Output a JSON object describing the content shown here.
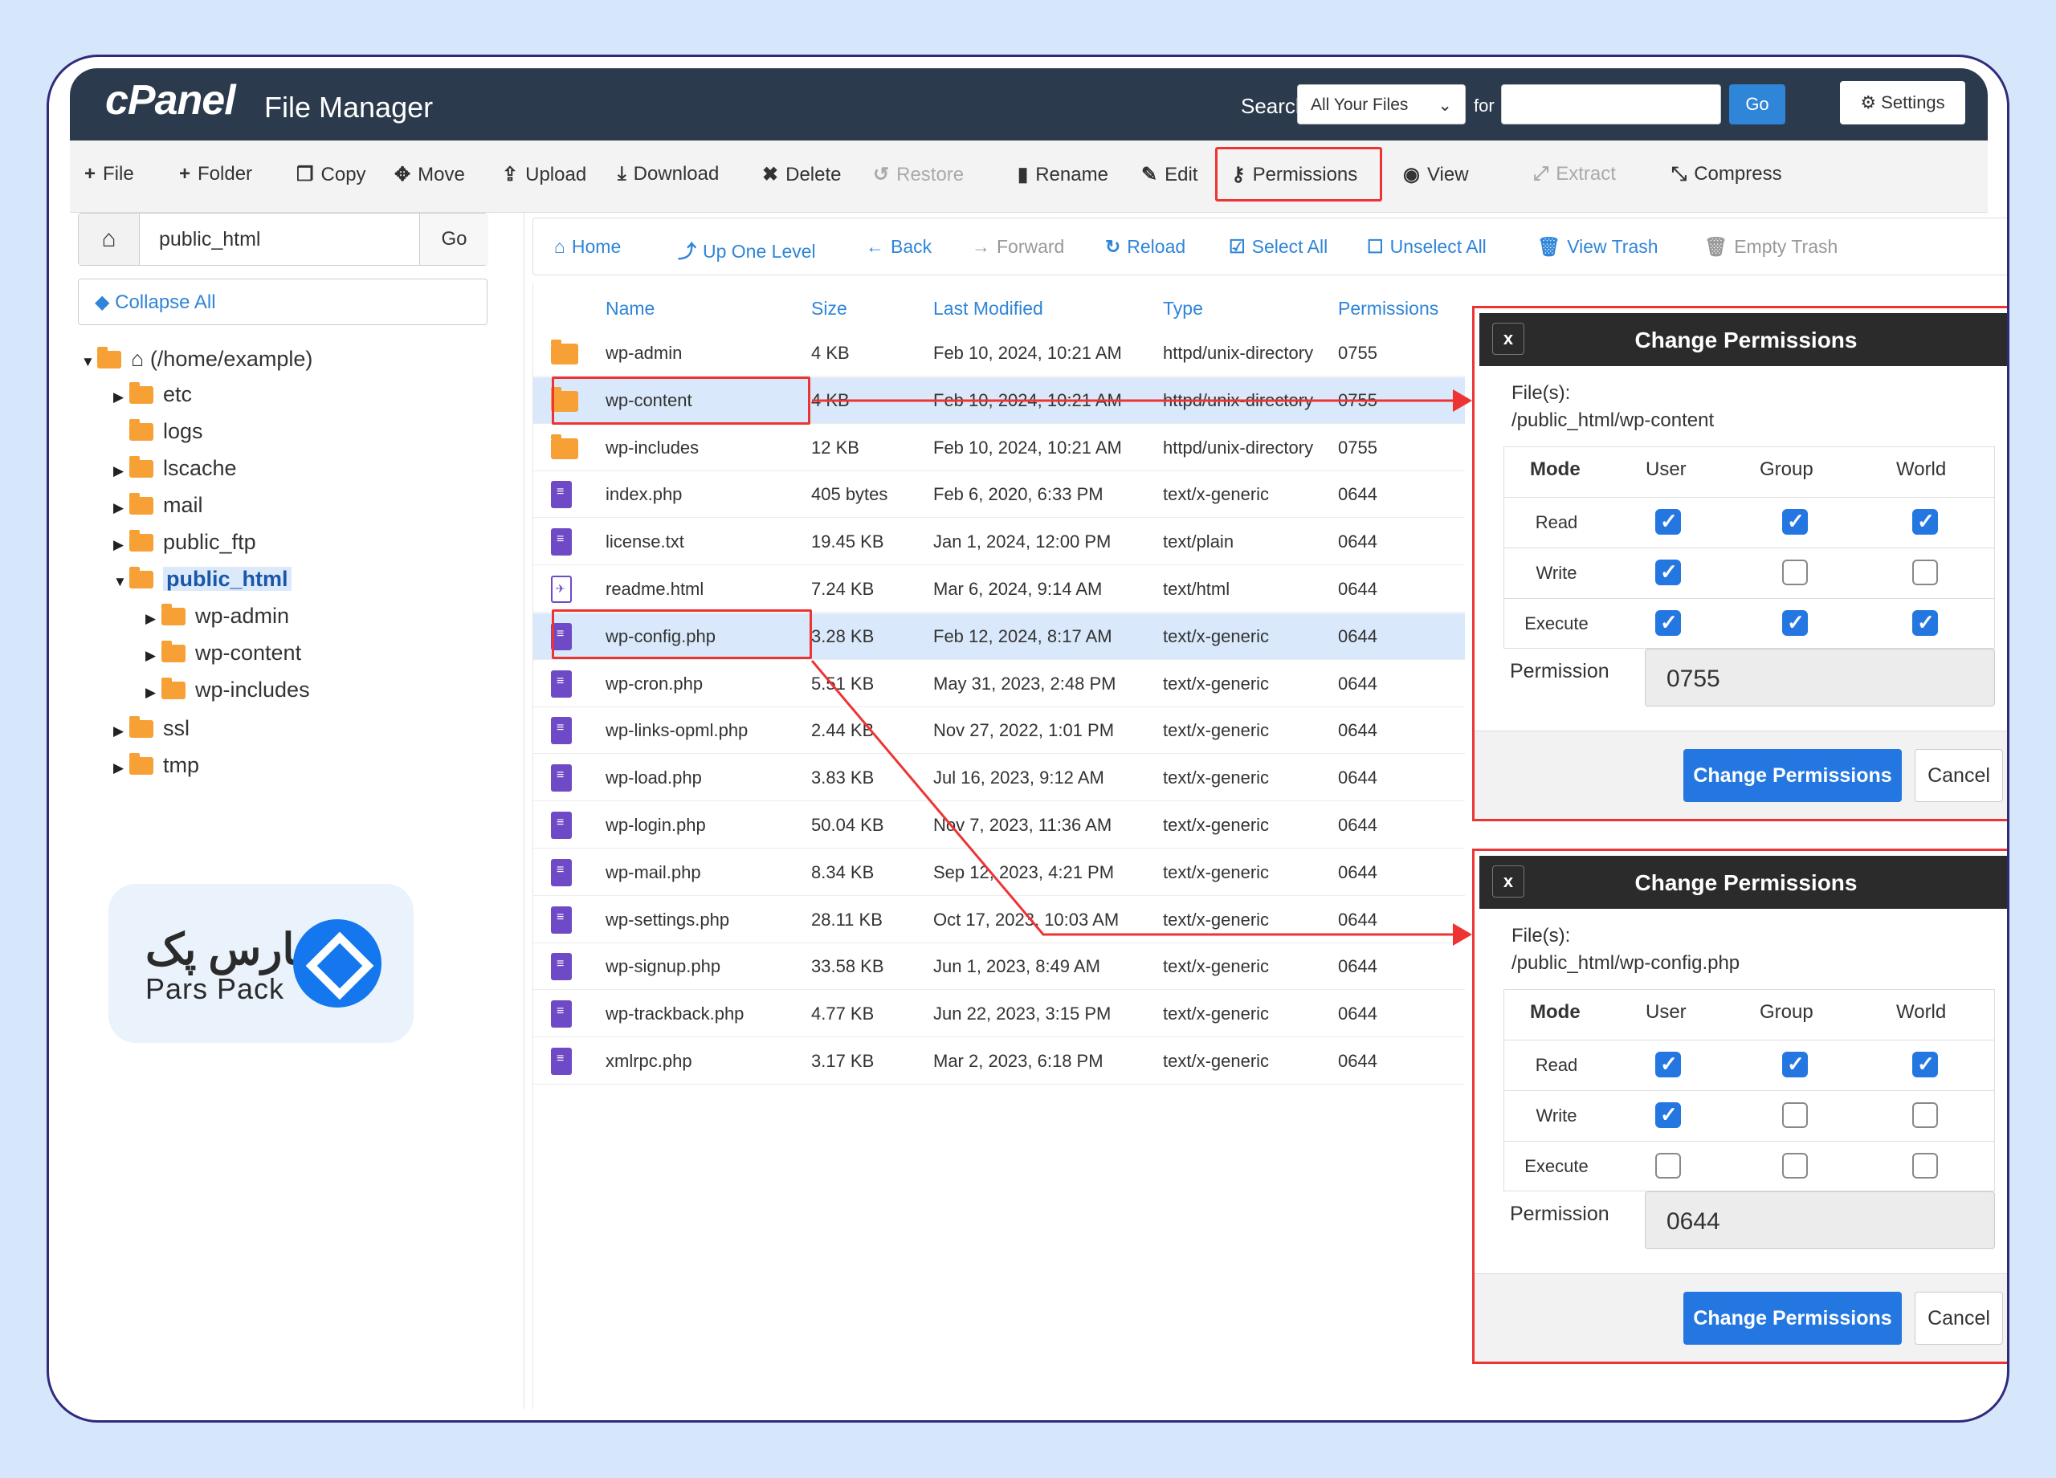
{
  "header": {
    "logo": "cPanel",
    "app_title": "File Manager",
    "search_label": "Search",
    "search_scope": "All Your Files",
    "for_label": "for",
    "search_value": "",
    "go_label": "Go",
    "settings_label": "Settings"
  },
  "toolbar": {
    "file": "File",
    "folder": "Folder",
    "copy": "Copy",
    "move": "Move",
    "upload": "Upload",
    "download": "Download",
    "delete": "Delete",
    "restore": "Restore",
    "rename": "Rename",
    "edit": "Edit",
    "permissions": "Permissions",
    "view": "View",
    "extract": "Extract",
    "compress": "Compress"
  },
  "sidebar": {
    "path": "public_html",
    "go": "Go",
    "collapse_all": "Collapse All",
    "tree": {
      "root": "(/home/example)",
      "etc": "etc",
      "logs": "logs",
      "lscache": "lscache",
      "mail": "mail",
      "public_ftp": "public_ftp",
      "public_html": "public_html",
      "wp_admin": "wp-admin",
      "wp_content": "wp-content",
      "wp_includes": "wp-includes",
      "ssl": "ssl",
      "tmp": "tmp"
    }
  },
  "brand": {
    "fa": "پارس پک",
    "en": "Pars Pack"
  },
  "nav": {
    "home": "Home",
    "up": "Up One Level",
    "back": "Back",
    "forward": "Forward",
    "reload": "Reload",
    "select_all": "Select All",
    "unselect_all": "Unselect All",
    "view_trash": "View Trash",
    "empty_trash": "Empty Trash"
  },
  "table": {
    "headers": {
      "name": "Name",
      "size": "Size",
      "modified": "Last Modified",
      "type": "Type",
      "permissions": "Permissions"
    },
    "rows": [
      {
        "name": "wp-admin",
        "size": "4 KB",
        "modified": "Feb 10, 2024, 10:21 AM",
        "type": "httpd/unix-directory",
        "perm": "0755"
      },
      {
        "name": "wp-content",
        "size": "4 KB",
        "modified": "Feb 10, 2024, 10:21 AM",
        "type": "httpd/unix-directory",
        "perm": "0755"
      },
      {
        "name": "wp-includes",
        "size": "12 KB",
        "modified": "Feb 10, 2024, 10:21 AM",
        "type": "httpd/unix-directory",
        "perm": "0755"
      },
      {
        "name": "index.php",
        "size": "405 bytes",
        "modified": "Feb 6, 2020, 6:33 PM",
        "type": "text/x-generic",
        "perm": "0644"
      },
      {
        "name": "license.txt",
        "size": "19.45 KB",
        "modified": "Jan 1, 2024, 12:00 PM",
        "type": "text/plain",
        "perm": "0644"
      },
      {
        "name": "readme.html",
        "size": "7.24 KB",
        "modified": "Mar 6, 2024, 9:14 AM",
        "type": "text/html",
        "perm": "0644"
      },
      {
        "name": "wp-config.php",
        "size": "3.28 KB",
        "modified": "Feb 12, 2024, 8:17 AM",
        "type": "text/x-generic",
        "perm": "0644"
      },
      {
        "name": "wp-cron.php",
        "size": "5.51 KB",
        "modified": "May 31, 2023, 2:48 PM",
        "type": "text/x-generic",
        "perm": "0644"
      },
      {
        "name": "wp-links-opml.php",
        "size": "2.44 KB",
        "modified": "Nov 27, 2022, 1:01 PM",
        "type": "text/x-generic",
        "perm": "0644"
      },
      {
        "name": "wp-load.php",
        "size": "3.83 KB",
        "modified": "Jul 16, 2023, 9:12 AM",
        "type": "text/x-generic",
        "perm": "0644"
      },
      {
        "name": "wp-login.php",
        "size": "50.04 KB",
        "modified": "Nov 7, 2023, 11:36 AM",
        "type": "text/x-generic",
        "perm": "0644"
      },
      {
        "name": "wp-mail.php",
        "size": "8.34 KB",
        "modified": "Sep 12, 2023, 4:21 PM",
        "type": "text/x-generic",
        "perm": "0644"
      },
      {
        "name": "wp-settings.php",
        "size": "28.11 KB",
        "modified": "Oct 17, 2023, 10:03 AM",
        "type": "text/x-generic",
        "perm": "0644"
      },
      {
        "name": "wp-signup.php",
        "size": "33.58 KB",
        "modified": "Jun 1, 2023, 8:49 AM",
        "type": "text/x-generic",
        "perm": "0644"
      },
      {
        "name": "wp-trackback.php",
        "size": "4.77 KB",
        "modified": "Jun 22, 2023, 3:15 PM",
        "type": "text/x-generic",
        "perm": "0644"
      },
      {
        "name": "xmlrpc.php",
        "size": "3.17 KB",
        "modified": "Mar 2, 2023, 6:18 PM",
        "type": "text/x-generic",
        "perm": "0644"
      }
    ]
  },
  "dialog_labels": {
    "close": "x",
    "title": "Change Permissions",
    "files_label": "File(s):",
    "mode": "Mode",
    "user": "User",
    "group": "Group",
    "world": "World",
    "read": "Read",
    "write": "Write",
    "execute": "Execute",
    "permission_label": "Permission",
    "submit": "Change Permissions",
    "cancel": "Cancel"
  },
  "dialogs": [
    {
      "file": "/public_html/wp-content",
      "value": "0755",
      "read": [
        true,
        true,
        true
      ],
      "write": [
        true,
        false,
        false
      ],
      "execute": [
        true,
        true,
        true
      ]
    },
    {
      "file": "/public_html/wp-config.php",
      "value": "0644",
      "read": [
        true,
        true,
        true
      ],
      "write": [
        true,
        false,
        false
      ],
      "execute": [
        false,
        false,
        false
      ]
    }
  ],
  "colors": {
    "header_bg": "#2b3a4c",
    "accent": "#2f85d8",
    "highlight": "#e33333",
    "checkbox": "#2477e0"
  }
}
